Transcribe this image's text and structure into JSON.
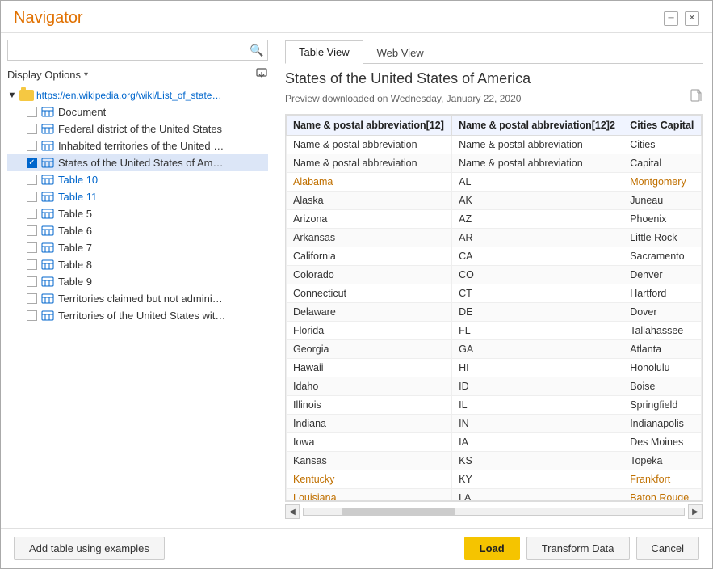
{
  "window": {
    "title": "Navigator"
  },
  "titleBar": {
    "controls": {
      "minimize": "─",
      "close": "✕"
    }
  },
  "leftPanel": {
    "search": {
      "placeholder": "",
      "searchIconLabel": "🔍"
    },
    "displayOptions": {
      "label": "Display Options",
      "chevron": "▾"
    },
    "importIcon": "⬆",
    "rootItem": {
      "label": "https://en.wikipedia.org/wiki/List_of_states_an..."
    },
    "treeItems": [
      {
        "id": 0,
        "label": "Document",
        "checked": false
      },
      {
        "id": 1,
        "label": "Federal district of the United States",
        "checked": false
      },
      {
        "id": 2,
        "label": "Inhabited territories of the United States",
        "checked": false
      },
      {
        "id": 3,
        "label": "States of the United States of America",
        "checked": true,
        "selected": true
      },
      {
        "id": 4,
        "label": "Table 10",
        "checked": false
      },
      {
        "id": 5,
        "label": "Table 11",
        "checked": false
      },
      {
        "id": 6,
        "label": "Table 5",
        "checked": false
      },
      {
        "id": 7,
        "label": "Table 6",
        "checked": false
      },
      {
        "id": 8,
        "label": "Table 7",
        "checked": false
      },
      {
        "id": 9,
        "label": "Table 8",
        "checked": false
      },
      {
        "id": 10,
        "label": "Table 9",
        "checked": false
      },
      {
        "id": 11,
        "label": "Territories claimed but not administered b...",
        "checked": false
      },
      {
        "id": 12,
        "label": "Territories of the United States with no in...",
        "checked": false
      }
    ]
  },
  "rightPanel": {
    "tabs": [
      {
        "id": "table",
        "label": "Table View",
        "active": true
      },
      {
        "id": "web",
        "label": "Web View",
        "active": false
      }
    ],
    "previewTitle": "States of the United States of America",
    "previewSubtitle": "Preview downloaded on Wednesday, January 22, 2020",
    "docIconLabel": "📄",
    "tableHeaders": [
      "Name & postal abbreviation[12]",
      "Name & postal abbreviation[12]2",
      "Cities Capital"
    ],
    "tableRows": [
      {
        "col1": "Name & postal abbreviation",
        "col2": "Name & postal abbreviation",
        "col3": "Cities",
        "orange": false
      },
      {
        "col1": "Name & postal abbreviation",
        "col2": "Name & postal abbreviation",
        "col3": "Capital",
        "orange": false
      },
      {
        "col1": "Alabama",
        "col2": "AL",
        "col3": "Montgomery",
        "orange": true
      },
      {
        "col1": "Alaska",
        "col2": "AK",
        "col3": "Juneau",
        "orange": false
      },
      {
        "col1": "Arizona",
        "col2": "AZ",
        "col3": "Phoenix",
        "orange": false
      },
      {
        "col1": "Arkansas",
        "col2": "AR",
        "col3": "Little Rock",
        "orange": false
      },
      {
        "col1": "California",
        "col2": "CA",
        "col3": "Sacramento",
        "orange": false
      },
      {
        "col1": "Colorado",
        "col2": "CO",
        "col3": "Denver",
        "orange": false
      },
      {
        "col1": "Connecticut",
        "col2": "CT",
        "col3": "Hartford",
        "orange": false
      },
      {
        "col1": "Delaware",
        "col2": "DE",
        "col3": "Dover",
        "orange": false
      },
      {
        "col1": "Florida",
        "col2": "FL",
        "col3": "Tallahassee",
        "orange": false
      },
      {
        "col1": "Georgia",
        "col2": "GA",
        "col3": "Atlanta",
        "orange": false
      },
      {
        "col1": "Hawaii",
        "col2": "HI",
        "col3": "Honolulu",
        "orange": false
      },
      {
        "col1": "Idaho",
        "col2": "ID",
        "col3": "Boise",
        "orange": false
      },
      {
        "col1": "Illinois",
        "col2": "IL",
        "col3": "Springfield",
        "orange": false
      },
      {
        "col1": "Indiana",
        "col2": "IN",
        "col3": "Indianapolis",
        "orange": false
      },
      {
        "col1": "Iowa",
        "col2": "IA",
        "col3": "Des Moines",
        "orange": false
      },
      {
        "col1": "Kansas",
        "col2": "KS",
        "col3": "Topeka",
        "orange": false
      },
      {
        "col1": "Kentucky",
        "col2": "KY",
        "col3": "Frankfort",
        "orange": true
      },
      {
        "col1": "Louisiana",
        "col2": "LA",
        "col3": "Baton Rouge",
        "orange": true
      }
    ]
  },
  "footer": {
    "addTableBtn": "Add table using examples",
    "loadBtn": "Load",
    "transformBtn": "Transform Data",
    "cancelBtn": "Cancel"
  }
}
